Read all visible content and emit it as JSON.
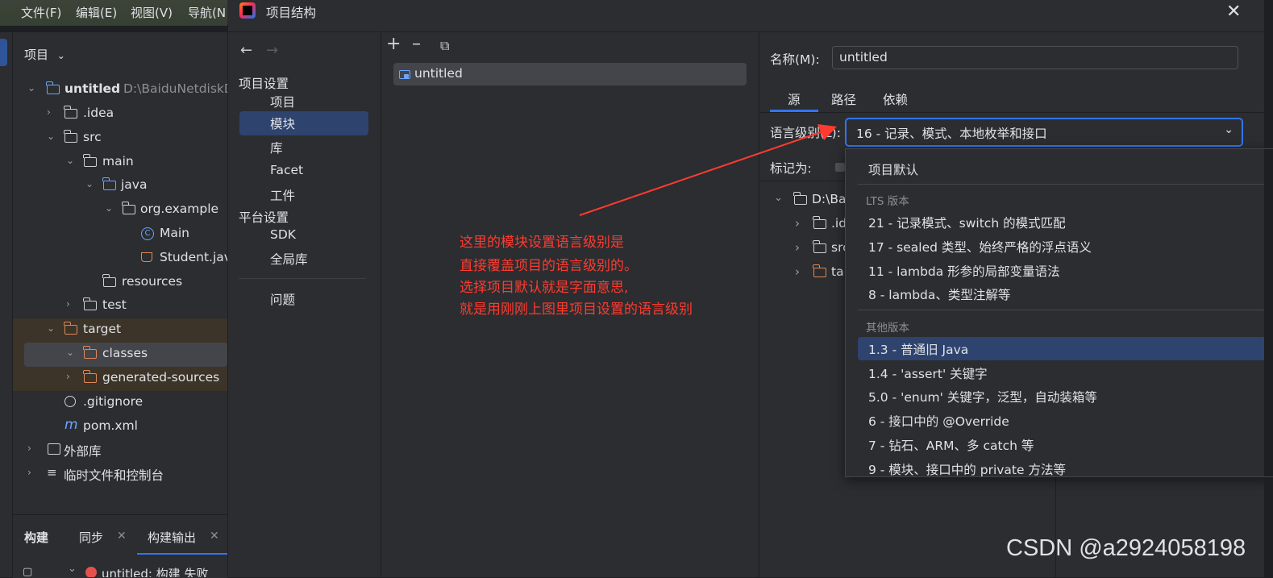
{
  "menubar": {
    "items": [
      "文件(F)",
      "编辑(E)",
      "视图(V)",
      "导航(N"
    ]
  },
  "project_panel": {
    "header": "项目",
    "tree": [
      {
        "label": "untitled",
        "extra": "D:\\BaiduNetdiskD"
      },
      {
        "label": ".idea"
      },
      {
        "label": "src"
      },
      {
        "label": "main"
      },
      {
        "label": "java"
      },
      {
        "label": "org.example"
      },
      {
        "label": "Main"
      },
      {
        "label": "Student.jav"
      },
      {
        "label": "resources"
      },
      {
        "label": "test"
      },
      {
        "label": "target"
      },
      {
        "label": "classes"
      },
      {
        "label": "generated-sources"
      },
      {
        "label": ".gitignore"
      },
      {
        "label": "pom.xml"
      },
      {
        "label": "外部库"
      },
      {
        "label": "临时文件和控制台"
      }
    ]
  },
  "bottom_tabs": {
    "build": "构建",
    "sync": "同步",
    "build_output": "构建输出",
    "status_line": "untitled: 构建 失败"
  },
  "dialog": {
    "title": "项目结构",
    "nav": {
      "project_settings_header": "项目设置",
      "project_settings": [
        "项目",
        "模块",
        "库",
        "Facet",
        "工件"
      ],
      "selected": "模块",
      "platform_settings_header": "平台设置",
      "platform_settings": [
        "SDK",
        "全局库"
      ],
      "problems": "问题"
    },
    "module_list": [
      "untitled"
    ],
    "name_label": "名称(M):",
    "name_value": "untitled",
    "tabs": [
      "源",
      "路径",
      "依赖"
    ],
    "active_tab": "源",
    "language_level_label": "语言级别(L):",
    "language_level_value": "16 - 记录、模式、本地枚举和接口",
    "mark_as_label": "标记为:",
    "content_tree": [
      "D:\\Ba",
      ".id",
      "src",
      "tar"
    ]
  },
  "dropdown": {
    "default_option": "项目默认",
    "lts_header": "LTS 版本",
    "lts_options": [
      "21 - 记录模式、switch 的模式匹配",
      "17 - sealed 类型、始终严格的浮点语义",
      "11 - lambda 形参的局部变量语法",
      "8 - lambda、类型注解等"
    ],
    "other_header": "其他版本",
    "other_options": [
      "1.3 - 普通旧 Java",
      "1.4 - 'assert' 关键字",
      "5.0 - 'enum' 关键字，泛型，自动装箱等",
      "6 - 接口中的 @Override",
      "7 - 钻石、ARM、多 catch 等",
      "9 - 模块、接口中的 private 方法等"
    ],
    "highlighted": "1.3 - 普通旧 Java"
  },
  "annotation": {
    "lines": [
      "这里的模块设置语言级别是",
      "直接覆盖项目的语言级别的。",
      "选择项目默认就是字面意思,",
      "就是用刚刚上图里项目设置的语言级别"
    ],
    "color": "#ff3b30"
  },
  "watermark": "CSDN @a2924058198",
  "colors": {
    "accent": "#3574f0",
    "selection": "#2e436e",
    "background": "#2b2d30"
  }
}
